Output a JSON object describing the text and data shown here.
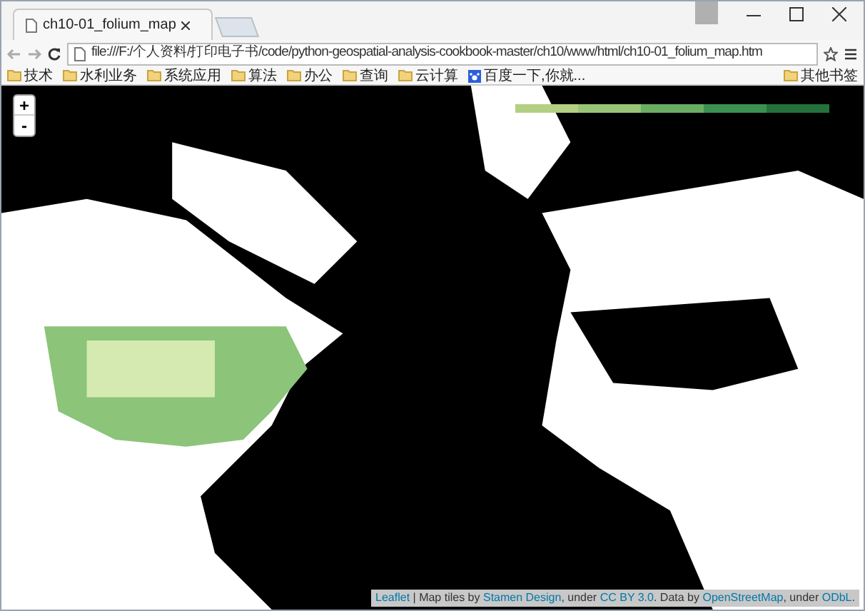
{
  "tab": {
    "title": "ch10-01_folium_map",
    "selected": true
  },
  "address_bar": {
    "url": "file:///F:/个人资料/打印电子书/code/python-geospatial-analysis-cookbook-master/ch10/www/html/ch10-01_folium_map.htm"
  },
  "bookmarks": [
    {
      "label": "技术",
      "kind": "folder"
    },
    {
      "label": "水利业务",
      "kind": "folder"
    },
    {
      "label": "系统应用",
      "kind": "folder"
    },
    {
      "label": "算法",
      "kind": "folder"
    },
    {
      "label": "办公",
      "kind": "folder"
    },
    {
      "label": "查询",
      "kind": "folder"
    },
    {
      "label": "云计算",
      "kind": "folder"
    },
    {
      "label": "百度一下,你就...",
      "kind": "page"
    }
  ],
  "other_bookmarks": "其他书签",
  "zoom_controls": [
    "+",
    "-"
  ],
  "legend": [
    {
      "color": "#b3cf82"
    },
    {
      "color": "#98c477"
    },
    {
      "color": "#6aae64"
    },
    {
      "color": "#3d9150"
    },
    {
      "color": "#25713b"
    }
  ],
  "attribution": [
    {
      "text": "Leaflet",
      "kind": "link"
    },
    {
      "text": " | Map tiles by ",
      "kind": "text"
    },
    {
      "text": "Stamen Design",
      "kind": "link"
    },
    {
      "text": ", under ",
      "kind": "text"
    },
    {
      "text": "CC BY 3.0",
      "kind": "link"
    },
    {
      "text": ". Data by ",
      "kind": "text"
    },
    {
      "text": "OpenStreetMap",
      "kind": "link"
    },
    {
      "text": ", under ",
      "kind": "text"
    },
    {
      "text": "ODbL",
      "kind": "link"
    },
    {
      "text": ".",
      "kind": "text"
    }
  ]
}
